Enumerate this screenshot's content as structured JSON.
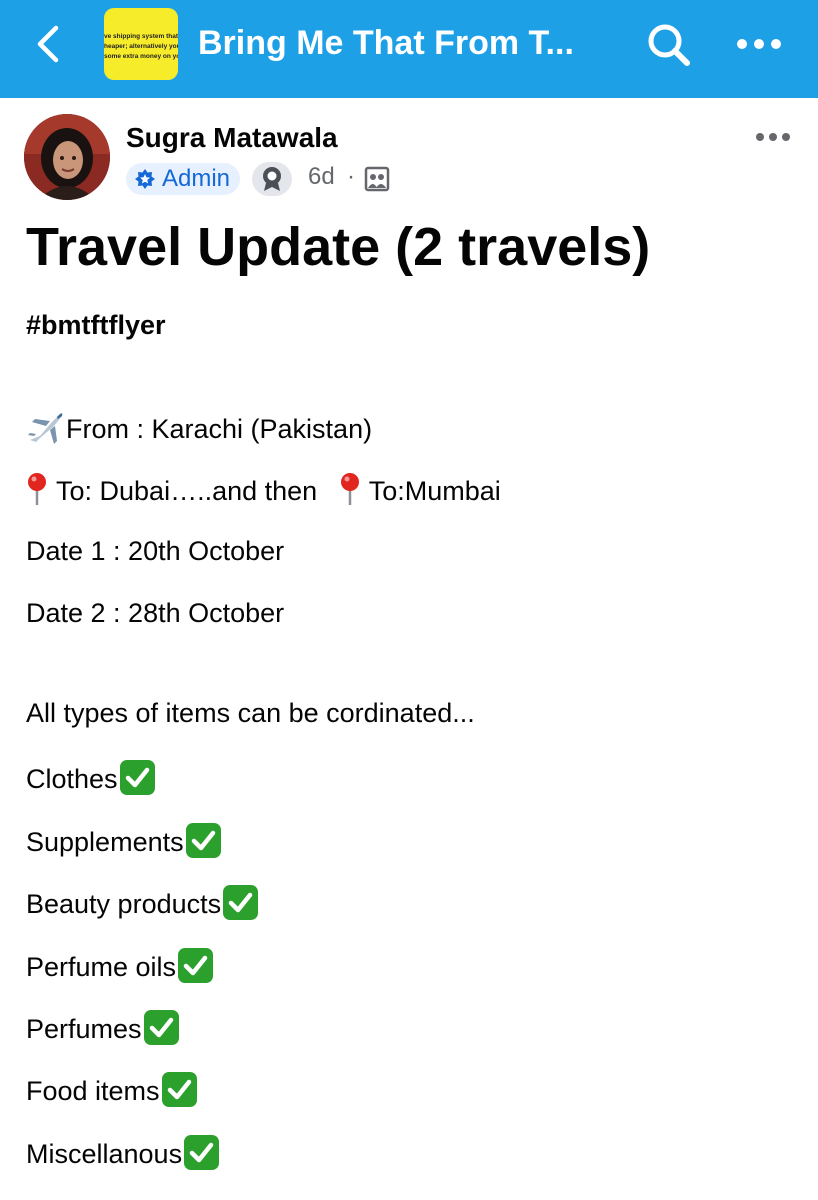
{
  "header": {
    "group_name": "Bring Me That From T...",
    "group_thumb_lines": [
      "ve shipping system that n",
      "heaper; alternatively you",
      "some extra money on you"
    ]
  },
  "post": {
    "author": "Sugra Matawala",
    "role_badge": "Admin",
    "time": "6d",
    "separator": "·",
    "title": "Travel Update (2 travels)",
    "hashtag": "#bmtftflyer",
    "from_line": "From : Karachi (Pakistan)",
    "to_first": "To: Dubai…..and then",
    "to_second": "To:Mumbai",
    "date1": "Date 1 : 20th October",
    "date2": "Date 2 : 28th October",
    "items_intro": "All types of items can be cordinated...",
    "items": [
      "Clothes",
      "Supplements",
      "Beauty products",
      "Perfume oils",
      "Perfumes",
      "Food items",
      "Miscellanous"
    ]
  },
  "colors": {
    "topbar": "#1ea0e6",
    "admin_text": "#1469d6",
    "admin_bg": "#e7f0fe",
    "check_green": "#2ca02c",
    "thumb_yellow": "#f7ec2a"
  },
  "icons": [
    "back-arrow-icon",
    "search-icon",
    "more-horizontal-icon",
    "admin-shield-icon",
    "rank-badge-icon",
    "audience-icon",
    "airplane-emoji-icon",
    "pin-emoji-icon",
    "check-mark-emoji-icon"
  ]
}
